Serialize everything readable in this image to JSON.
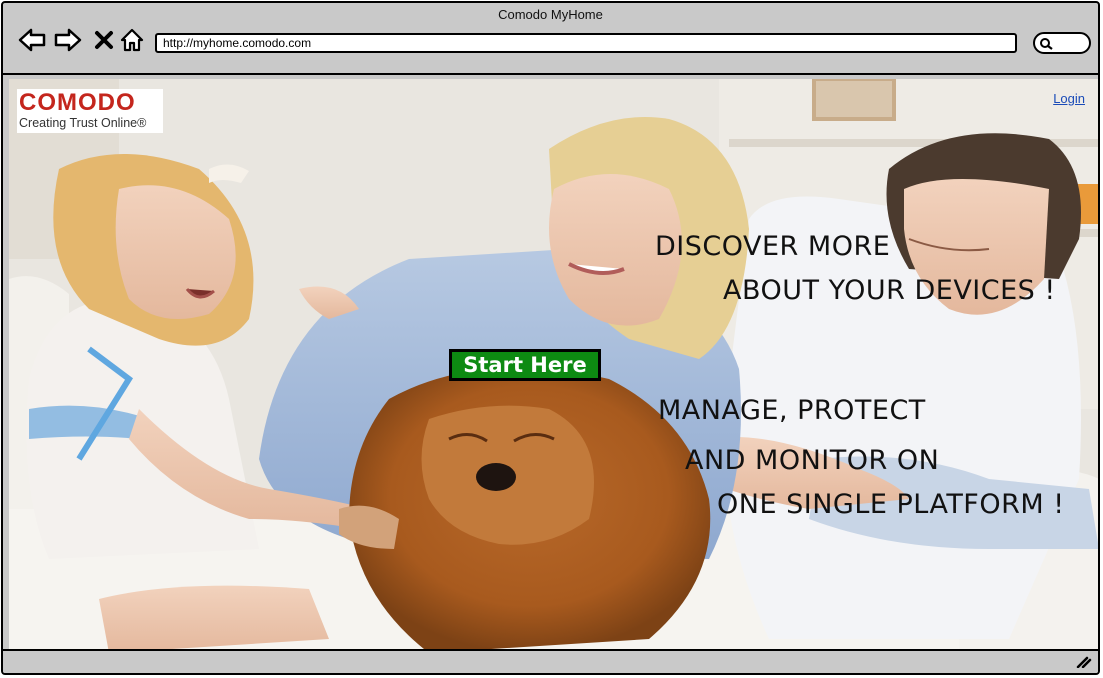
{
  "window": {
    "title": "Comodo MyHome",
    "url": "http://myhome.comodo.com"
  },
  "nav": {
    "back_icon": "back-arrow-icon",
    "forward_icon": "forward-arrow-icon",
    "stop_icon": "close-icon",
    "home_icon": "home-icon",
    "search_icon": "search-icon"
  },
  "header": {
    "logo_text": "COMODO",
    "logo_tagline": "Creating Trust Online®",
    "login_label": "Login"
  },
  "hero": {
    "image": "family-with-dog-photo",
    "start_label": "Start Here",
    "headline_1": {
      "line1": "DISCOVER MORE",
      "line2": "ABOUT YOUR DEVICES !"
    },
    "headline_2": {
      "line1": "MANAGE, PROTECT",
      "line2": "AND MONITOR ON",
      "line3": "ONE SINGLE PLATFORM !"
    }
  },
  "colors": {
    "brand_red": "#c4261d",
    "cta_green": "#0d8a12",
    "link_blue": "#1a4bb8",
    "chrome_gray": "#c9c9c9"
  }
}
